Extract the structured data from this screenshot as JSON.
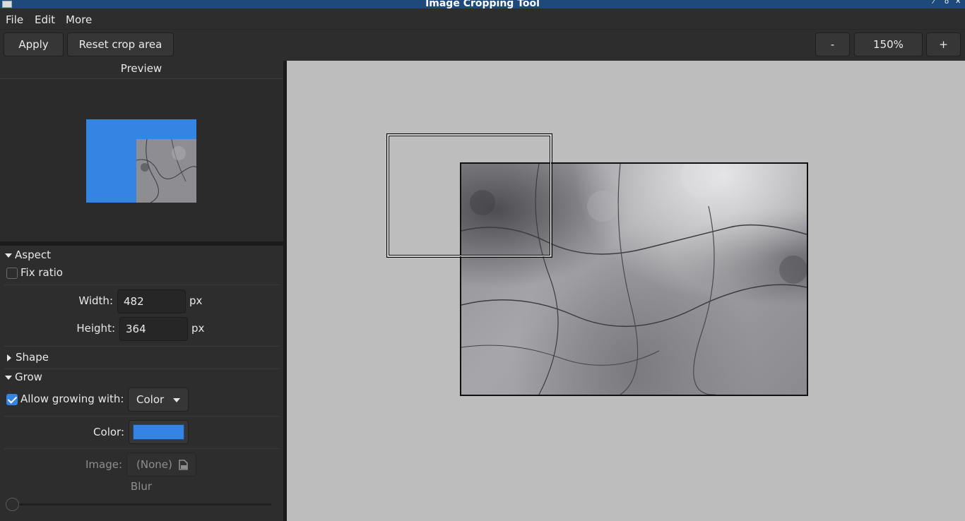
{
  "window": {
    "title": "Image Cropping Tool"
  },
  "menu": {
    "file": "File",
    "edit": "Edit",
    "more": "More"
  },
  "toolbar": {
    "apply": "Apply",
    "reset": "Reset crop area",
    "zoom_out": "-",
    "zoom": "150%",
    "zoom_in": "+"
  },
  "sidebar": {
    "preview_title": "Preview",
    "aspect": {
      "title": "Aspect",
      "fix_ratio": "Fix ratio",
      "fix_ratio_checked": false,
      "width_label": "Width:",
      "width_value": "482",
      "width_unit": "px",
      "height_label": "Height:",
      "height_value": "364",
      "height_unit": "px"
    },
    "shape": {
      "title": "Shape"
    },
    "grow": {
      "title": "Grow",
      "allow_label": "Allow growing with:",
      "allow_checked": true,
      "mode": "Color",
      "color_label": "Color:",
      "color_value": "#3584e4",
      "image_label": "Image:",
      "image_value": "(None)",
      "blur_label": "Blur",
      "blur_value": 0
    }
  },
  "colors": {
    "accent": "#3584e4",
    "titlebar": "#1d4a7a",
    "canvas_bg": "#bdbdbd"
  },
  "icons": {
    "image_picker": "document-open-icon"
  }
}
